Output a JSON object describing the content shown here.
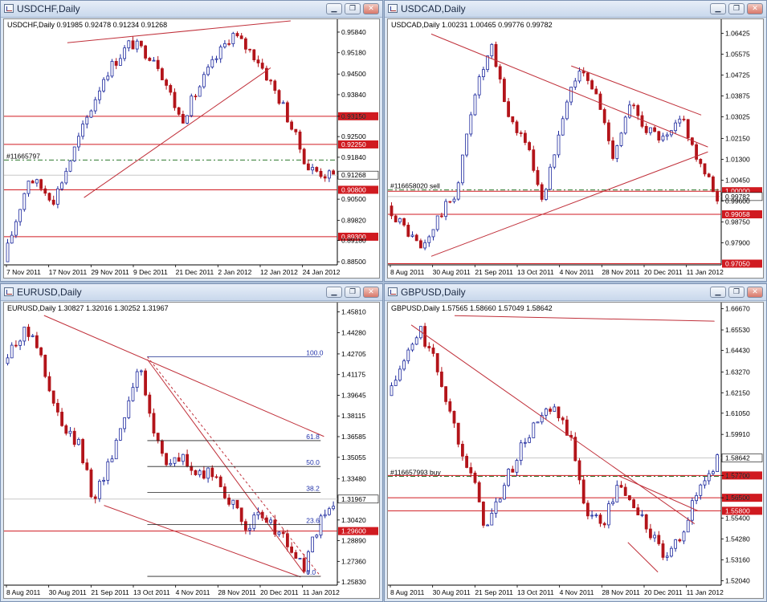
{
  "colors": {
    "bull": "#1e2a9e",
    "bear": "#b3141a",
    "trend": "#c0303a",
    "level": "#d01a20",
    "order": "#2f7a2f",
    "fib": "#202020",
    "fibtext": "#2233aa"
  },
  "windows": [
    {
      "id": "usdchf",
      "title": "USDCHF,Daily",
      "header": "USDCHF,Daily  0.91985 0.92478 0.91234 0.91268",
      "buttons": [
        "minimize-icon",
        "restore-icon",
        "close-icon"
      ],
      "y_range": [
        0.884,
        0.9625
      ],
      "price_ticks": [
        "0.95840",
        "0.95180",
        "0.94500",
        "0.93840",
        "0.93150",
        "0.92500",
        "0.91840",
        "0.91268",
        "0.90500",
        "0.89820",
        "0.89180",
        "0.88500"
      ],
      "date_labels": [
        "7 Nov 2011",
        "17 Nov 2011",
        "29 Nov 2011",
        "9 Dec 2011",
        "21 Dec 2011",
        "2 Jan 2012",
        "12 Jan 2012",
        "24 Jan 2012"
      ],
      "levels": [
        {
          "price": 0.9315,
          "tag": "0.93150"
        },
        {
          "price": 0.9225,
          "tag": "0.92250"
        },
        {
          "price": 0.908,
          "tag": "0.90800"
        },
        {
          "price": 0.893,
          "tag": "0.89300"
        }
      ],
      "current": {
        "price": 0.91268,
        "label": "0.91268"
      },
      "order": {
        "price": 0.9175,
        "label": "#11665797"
      },
      "anchors": [
        0.885,
        0.912,
        0.905,
        0.925,
        0.945,
        0.955,
        0.95,
        0.93,
        0.945,
        0.958,
        0.95,
        0.935,
        0.915,
        0.912
      ],
      "trendlines": [
        [
          0.19,
          0.955,
          0.86,
          0.962
        ],
        [
          0.24,
          0.9055,
          0.8,
          0.947
        ]
      ],
      "fib": null
    },
    {
      "id": "usdcad",
      "title": "USDCAD,Daily",
      "header": "USDCAD,Daily  1.00231 1.00465 0.99776 0.99782",
      "buttons": [
        "minimize-icon",
        "restore-icon",
        "close-icon"
      ],
      "y_range": [
        0.97,
        1.07
      ],
      "price_ticks": [
        "1.06425",
        "1.05575",
        "1.04725",
        "1.03875",
        "1.03025",
        "1.02150",
        "1.01300",
        "1.00450",
        "0.99600",
        "0.98750",
        "0.97900",
        "0.97050"
      ],
      "date_labels": [
        "8 Aug 2011",
        "30 Aug 2011",
        "21 Sep 2011",
        "13 Oct 2011",
        "4 Nov 2011",
        "28 Nov 2011",
        "20 Dec 2011",
        "11 Jan 2012"
      ],
      "levels": [
        {
          "price": 1.0,
          "tag": "1.00000"
        },
        {
          "price": 0.99058,
          "tag": "0.99058"
        },
        {
          "price": 0.9705,
          "tag": "0.97050"
        }
      ],
      "current": {
        "price": 0.99782,
        "label": "0.99782"
      },
      "order": {
        "price": 1.0005,
        "label": "#116658020 sell"
      },
      "anchors": [
        0.994,
        0.985,
        0.976,
        0.99,
        1.0,
        1.04,
        1.058,
        1.03,
        1.02,
        0.995,
        1.03,
        1.05,
        1.04,
        1.015,
        1.035,
        1.025,
        1.02,
        1.03,
        1.01,
        0.998
      ],
      "trendlines": [
        [
          0.13,
          1.064,
          0.96,
          1.018
        ],
        [
          0.13,
          0.9735,
          0.96,
          1.016
        ],
        [
          0.55,
          1.051,
          0.94,
          1.031
        ]
      ],
      "fib": null
    },
    {
      "id": "eurusd",
      "title": "EURUSD,Daily",
      "header": "EURUSD,Daily  1.30827 1.32016 1.30252 1.31967",
      "buttons": [
        "minimize-icon",
        "restore-icon",
        "close-icon"
      ],
      "y_range": [
        1.256,
        1.465
      ],
      "price_ticks": [
        "1.45810",
        "1.44280",
        "1.42705",
        "1.41175",
        "1.39645",
        "1.38115",
        "1.36585",
        "1.35055",
        "1.33480",
        "1.31967",
        "1.30420",
        "1.28890",
        "1.27360",
        "1.25830"
      ],
      "date_labels": [
        "8 Aug 2011",
        "30 Aug 2011",
        "21 Sep 2011",
        "13 Oct 2011",
        "4 Nov 2011",
        "28 Nov 2011",
        "20 Dec 2011",
        "11 Jan 2012"
      ],
      "levels": [
        {
          "price": 1.296,
          "tag": "1.29600"
        }
      ],
      "current": {
        "price": 1.31967,
        "label": "1.31967"
      },
      "order": null,
      "anchors": [
        1.42,
        1.44,
        1.445,
        1.4,
        1.37,
        1.36,
        1.32,
        1.345,
        1.38,
        1.42,
        1.37,
        1.345,
        1.35,
        1.335,
        1.34,
        1.32,
        1.3,
        1.305,
        1.3,
        1.285,
        1.268,
        1.3,
        1.315
      ],
      "trendlines": [
        [
          0.12,
          1.4555,
          0.96,
          1.366
        ],
        [
          0.3,
          1.315,
          0.89,
          1.262
        ],
        [
          0.43,
          1.423,
          0.9,
          1.265
        ]
      ],
      "fib": {
        "x0": 0.43,
        "x1": 0.95,
        "high": 1.425,
        "low": 1.2625,
        "levels": [
          "100.0",
          "61.8",
          "50.0",
          "38.2",
          "23.6",
          "0.0"
        ]
      }
    },
    {
      "id": "gbpusd",
      "title": "GBPUSD,Daily",
      "header": "GBPUSD,Daily  1.57565 1.58660 1.57049 1.58642",
      "buttons": [
        "minimize-icon",
        "restore-icon",
        "close-icon"
      ],
      "y_range": [
        1.518,
        1.67
      ],
      "price_ticks": [
        "1.66670",
        "1.65530",
        "1.64430",
        "1.63270",
        "1.62150",
        "1.61050",
        "1.59910",
        "1.58642",
        "1.57700",
        "1.56500",
        "1.55400",
        "1.54280",
        "1.53160",
        "1.52040"
      ],
      "date_labels": [
        "8 Aug 2011",
        "30 Aug 2011",
        "21 Sep 2011",
        "13 Oct 2011",
        "4 Nov 2011",
        "28 Nov 2011",
        "20 Dec 2011",
        "11 Jan 2012"
      ],
      "levels": [
        {
          "price": 1.577,
          "tag": "1.57700"
        },
        {
          "price": 1.565,
          "tag": "1.56500"
        },
        {
          "price": 1.558,
          "tag": "1.55800"
        }
      ],
      "current": {
        "price": 1.58642,
        "label": "1.58642"
      },
      "order": {
        "price": 1.5765,
        "label": "#116657993 buy"
      },
      "anchors": [
        1.62,
        1.638,
        1.655,
        1.635,
        1.605,
        1.58,
        1.548,
        1.57,
        1.59,
        1.605,
        1.612,
        1.6,
        1.56,
        1.55,
        1.572,
        1.56,
        1.545,
        1.53,
        1.55,
        1.572,
        1.586
      ],
      "trendlines": [
        [
          0.07,
          1.658,
          0.92,
          1.551
        ],
        [
          0.2,
          1.663,
          0.98,
          1.66
        ],
        [
          0.69,
          1.577,
          0.93,
          1.558
        ],
        [
          0.72,
          1.541,
          0.81,
          1.525
        ]
      ],
      "fib": null
    }
  ]
}
